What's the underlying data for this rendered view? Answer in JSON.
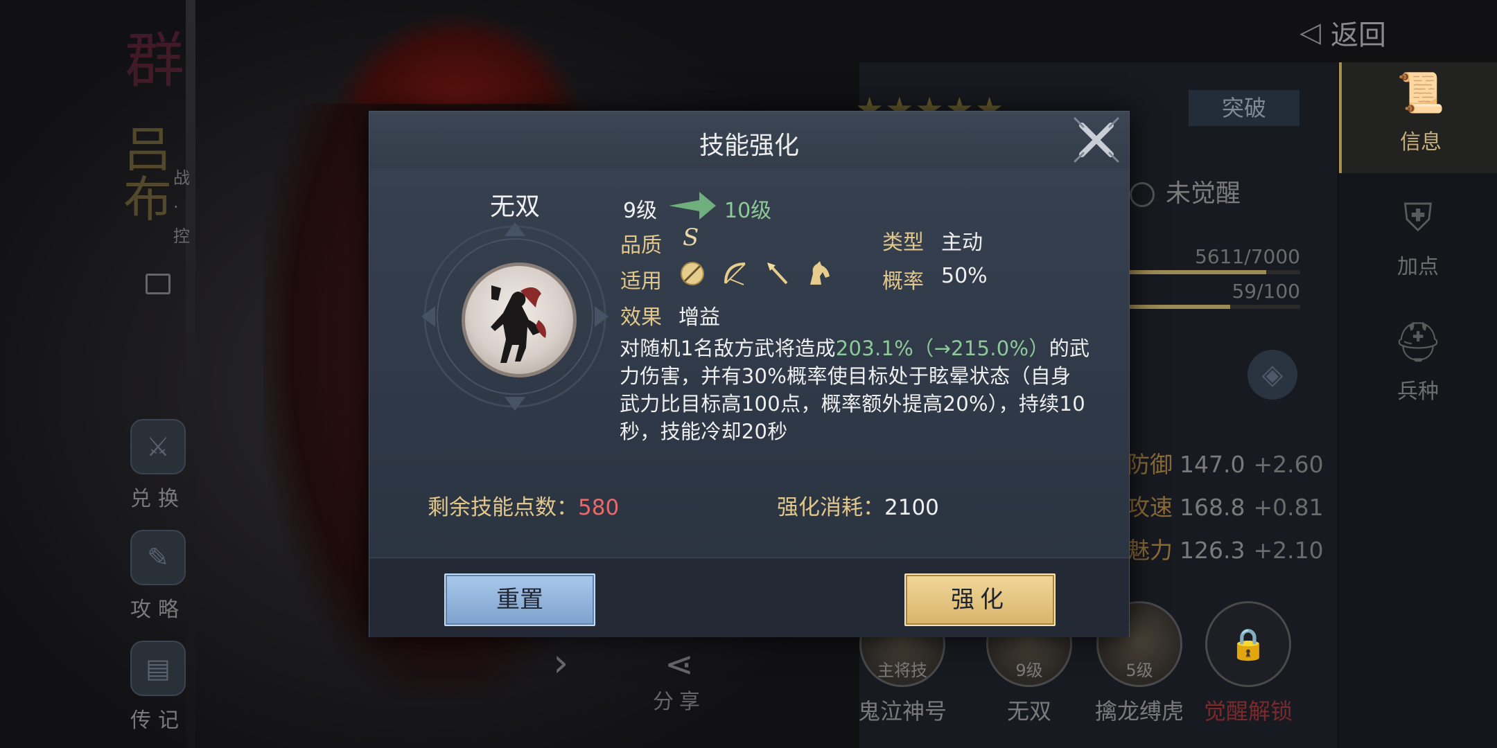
{
  "back": {
    "label": "返回"
  },
  "hero": {
    "title_vertical": "群",
    "name_vertical": "吕布",
    "class_tag": "战·控"
  },
  "left_menu": [
    {
      "label": "兑换",
      "icon": "exchange-icon"
    },
    {
      "label": "攻略",
      "icon": "guide-icon"
    },
    {
      "label": "传记",
      "icon": "biography-icon"
    }
  ],
  "right_nav": [
    {
      "label": "信息",
      "icon": "scroll-icon",
      "active": true
    },
    {
      "label": "加点",
      "icon": "armor-plus-icon",
      "active": false
    },
    {
      "label": "兵种",
      "icon": "helmet-icon",
      "active": false
    }
  ],
  "hero_panel": {
    "breakthrough_label": "突破",
    "awaken_status": "未觉醒",
    "exp_text": "5611/7000",
    "exp_fraction": 0.8016,
    "bar2_text": "59/100",
    "bar2_fraction": 0.59,
    "stats": [
      {
        "name": "防御",
        "value": "147.0",
        "plus": "+2.60"
      },
      {
        "name": "攻速",
        "value": "168.8",
        "plus": "+0.81"
      },
      {
        "name": "魅力",
        "value": "126.3",
        "plus": "+2.10"
      }
    ]
  },
  "skill_slots": [
    {
      "tag": "主将技",
      "name": "鬼泣神号",
      "locked": false
    },
    {
      "tag": "9级",
      "name": "无双",
      "locked": false
    },
    {
      "tag": "5级",
      "name": "擒龙缚虎",
      "locked": false
    },
    {
      "tag": "",
      "name": "觉醒解锁",
      "locked": true
    }
  ],
  "share": {
    "label": "分享"
  },
  "modal": {
    "title": "技能强化",
    "skill_name": "无双",
    "level_from": "9级",
    "level_to": "10级",
    "quality_label": "品质",
    "quality_value": "S",
    "type_label": "类型",
    "type_value": "主动",
    "apply_label": "适用",
    "apply_icons": [
      "shield-icon",
      "bow-icon",
      "spear-icon",
      "horse-icon"
    ],
    "chance_label": "概率",
    "chance_value": "50%",
    "effect_label": "效果",
    "effect_value": "增益",
    "desc_prefix": "对随机1名敌方武将造成",
    "desc_highlight": "203.1%（→215.0%）",
    "desc_suffix": "的武力伤害，并有30%概率使目标处于眩晕状态（自身武力比目标高100点，概率额外提高20%），持续10秒，技能冷却20秒",
    "points_label": "剩余技能点数：",
    "points_value": "580",
    "cost_label": "强化消耗：",
    "cost_value": "2100",
    "reset_label": "重置",
    "upgrade_label": "强化"
  },
  "colors": {
    "accent_gold": "#e2c78c",
    "green_text": "#8ec99a",
    "red_number": "#e86a6a",
    "reset_button": "#8fb3dd",
    "upgrade_button": "#e3c27f"
  }
}
